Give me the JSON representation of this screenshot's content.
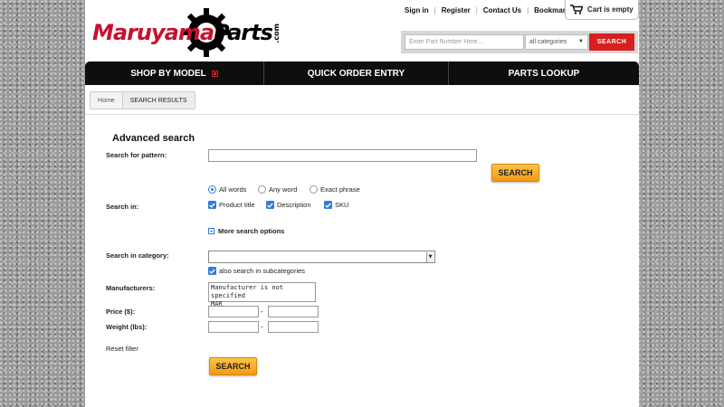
{
  "brand": {
    "part1": "Maruyama",
    "part2": "Parts",
    "suffix": ".com"
  },
  "toplinks": [
    "Sign in",
    "Register",
    "Contact Us",
    "Bookmark"
  ],
  "cart": {
    "label": "Cart is empty"
  },
  "search": {
    "placeholder": "Enter Part Number Here...",
    "category": "all categories",
    "button": "SEARCH"
  },
  "nav": [
    {
      "label": "SHOP BY MODEL"
    },
    {
      "label": "QUICK ORDER ENTRY"
    },
    {
      "label": "PARTS LOOKUP"
    }
  ],
  "breadcrumb": [
    "Home",
    "SEARCH RESULTS"
  ],
  "form": {
    "title": "Advanced search",
    "pattern_label": "Search for pattern:",
    "pattern_value": "",
    "search_button": "SEARCH",
    "match_options": [
      "All words",
      "Any word",
      "Exact phrase"
    ],
    "match_selected": "All words",
    "search_in_label": "Search in:",
    "search_in": [
      "Product title",
      "Description",
      "SKU"
    ],
    "more_options": "More search options",
    "category_label": "Search in category:",
    "category_value": "",
    "subcategories": "also search in subcategories",
    "manufacturers_label": "Manufacturers:",
    "manufacturers": [
      "Manufacturer is not specified",
      "MAR"
    ],
    "price_label": "Price ($):",
    "weight_label": "Weight (lbs):",
    "range_sep": "-",
    "reset": "Reset filter",
    "bottom_button": "SEARCH"
  },
  "colors": {
    "accent_red": "#d7201e",
    "nav_bg": "#0e0e0e",
    "button_orange": "#f39a13",
    "checkbox_blue": "#2f7fd8"
  }
}
